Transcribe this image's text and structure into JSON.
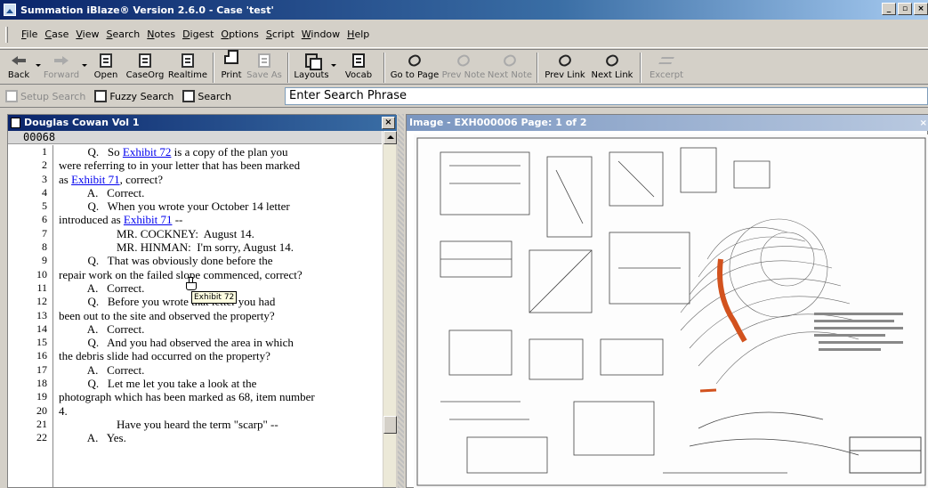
{
  "window": {
    "title": "Summation iBlaze® Version 2.6.0 - Case 'test'"
  },
  "menu": [
    "File",
    "Case",
    "View",
    "Search",
    "Notes",
    "Digest",
    "Options",
    "Script",
    "Window",
    "Help"
  ],
  "toolbar": {
    "back": "Back",
    "forward": "Forward",
    "open": "Open",
    "caseorg": "CaseOrg",
    "realtime": "Realtime",
    "print": "Print",
    "save_as": "Save As",
    "layouts": "Layouts",
    "vocab": "Vocab",
    "go_to_page": "Go to Page",
    "prev_note": "Prev Note",
    "next_note": "Next Note",
    "prev_link": "Prev Link",
    "next_link": "Next Link",
    "excerpt": "Excerpt"
  },
  "searchbar": {
    "setup_search": "Setup Search",
    "fuzzy_search": "Fuzzy Search",
    "search": "Search",
    "phrase": "Enter Search Phrase"
  },
  "transcript": {
    "title": "Douglas Cowan Vol 1",
    "page": "00068",
    "tooltip": "Exhibit 72",
    "lines": [
      {
        "n": "1",
        "parts": [
          {
            "t": "          Q.   So "
          },
          {
            "t": "Exhibit 72",
            "link": true
          },
          {
            "t": " is a copy of the plan you"
          }
        ]
      },
      {
        "n": "2",
        "parts": [
          {
            "t": "were referring to in your letter that has been marked"
          }
        ]
      },
      {
        "n": "3",
        "parts": [
          {
            "t": "as "
          },
          {
            "t": "Exhibit 71",
            "link": true
          },
          {
            "t": ", correct?"
          }
        ]
      },
      {
        "n": "4",
        "parts": [
          {
            "t": "          A.   Correct."
          }
        ]
      },
      {
        "n": "5",
        "parts": [
          {
            "t": "          Q.   When you wrote your October 14 letter"
          }
        ]
      },
      {
        "n": "6",
        "parts": [
          {
            "t": "introduced as "
          },
          {
            "t": "Exhibit 71",
            "link": true
          },
          {
            "t": " --"
          }
        ]
      },
      {
        "n": "7",
        "parts": [
          {
            "t": "                    MR. COCKNEY:  August 14."
          }
        ]
      },
      {
        "n": "8",
        "parts": [
          {
            "t": "                    MR. HINMAN:  I'm sorry, August 14."
          }
        ]
      },
      {
        "n": "9",
        "parts": [
          {
            "t": "          Q.   That was obviously done before the"
          }
        ]
      },
      {
        "n": "10",
        "parts": [
          {
            "t": "repair work on the failed slope commenced, correct?"
          }
        ]
      },
      {
        "n": "11",
        "parts": [
          {
            "t": "          A.   Correct."
          }
        ]
      },
      {
        "n": "12",
        "parts": [
          {
            "t": "          Q.   Before you wrote that letter you had"
          }
        ]
      },
      {
        "n": "13",
        "parts": [
          {
            "t": "been out to the site and observed the property?"
          }
        ]
      },
      {
        "n": "14",
        "parts": [
          {
            "t": "          A.   Correct."
          }
        ]
      },
      {
        "n": "15",
        "parts": [
          {
            "t": "          Q.   And you had observed the area in which"
          }
        ]
      },
      {
        "n": "16",
        "parts": [
          {
            "t": "the debris slide had occurred on the property?"
          }
        ]
      },
      {
        "n": "17",
        "parts": [
          {
            "t": "          A.   Correct."
          }
        ]
      },
      {
        "n": "18",
        "parts": [
          {
            "t": "          Q.   Let me let you take a look at the"
          }
        ]
      },
      {
        "n": "19",
        "parts": [
          {
            "t": "photograph which has been marked as 68, item number"
          }
        ]
      },
      {
        "n": "20",
        "parts": [
          {
            "t": "4."
          }
        ]
      },
      {
        "n": "21",
        "parts": [
          {
            "t": "                    Have you heard the term \"scarp\" --"
          }
        ]
      },
      {
        "n": "22",
        "parts": [
          {
            "t": "          A.   Yes."
          }
        ]
      }
    ]
  },
  "image_panel": {
    "title": "Image - EXH000006 Page: 1 of 2"
  },
  "colors": {
    "titlebar": "#0a246a",
    "link": "#0000ee",
    "tooltip_bg": "#ffffe1",
    "highlight_orange": "#d2521e"
  }
}
